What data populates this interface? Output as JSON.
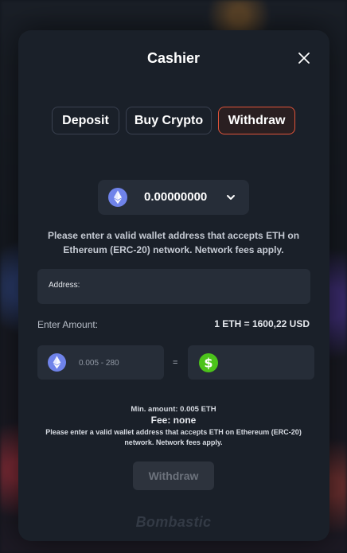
{
  "modal": {
    "title": "Cashier",
    "close_icon": "close-icon"
  },
  "tabs": [
    {
      "label": "Deposit",
      "active": false
    },
    {
      "label": "Buy Crypto",
      "active": false
    },
    {
      "label": "Withdraw",
      "active": true
    }
  ],
  "currency_selector": {
    "icon": "ethereum-icon",
    "balance": "0.00000000",
    "chevron_icon": "chevron-down-icon"
  },
  "notice": "Please enter a valid wallet address that accepts ETH on Ethereum (ERC-20) network. Network fees apply.",
  "address": {
    "label": "Address:",
    "value": ""
  },
  "amount": {
    "label": "Enter Amount:",
    "rate": "1 ETH = 1600,22 USD",
    "crypto_icon": "ethereum-icon",
    "crypto_placeholder": "0.005 - 280",
    "equals": "=",
    "fiat_icon": "dollar-icon",
    "fiat_value": ""
  },
  "limits": {
    "min_amount": "Min. amount: 0.005 ETH",
    "fee": "Fee: none",
    "notice_prefix": "Please enter a valid wallet address that accepts ETH on ",
    "notice_network": "Ethereum (ERC-20)",
    "notice_suffix": " network. Network fees apply."
  },
  "withdraw_button": "Withdraw",
  "brand": "Bombastic",
  "colors": {
    "accent": "#e0533a",
    "eth": "#6f83ea",
    "usd": "#4cc31b",
    "panel": "#1a2029",
    "field": "#262d38"
  }
}
